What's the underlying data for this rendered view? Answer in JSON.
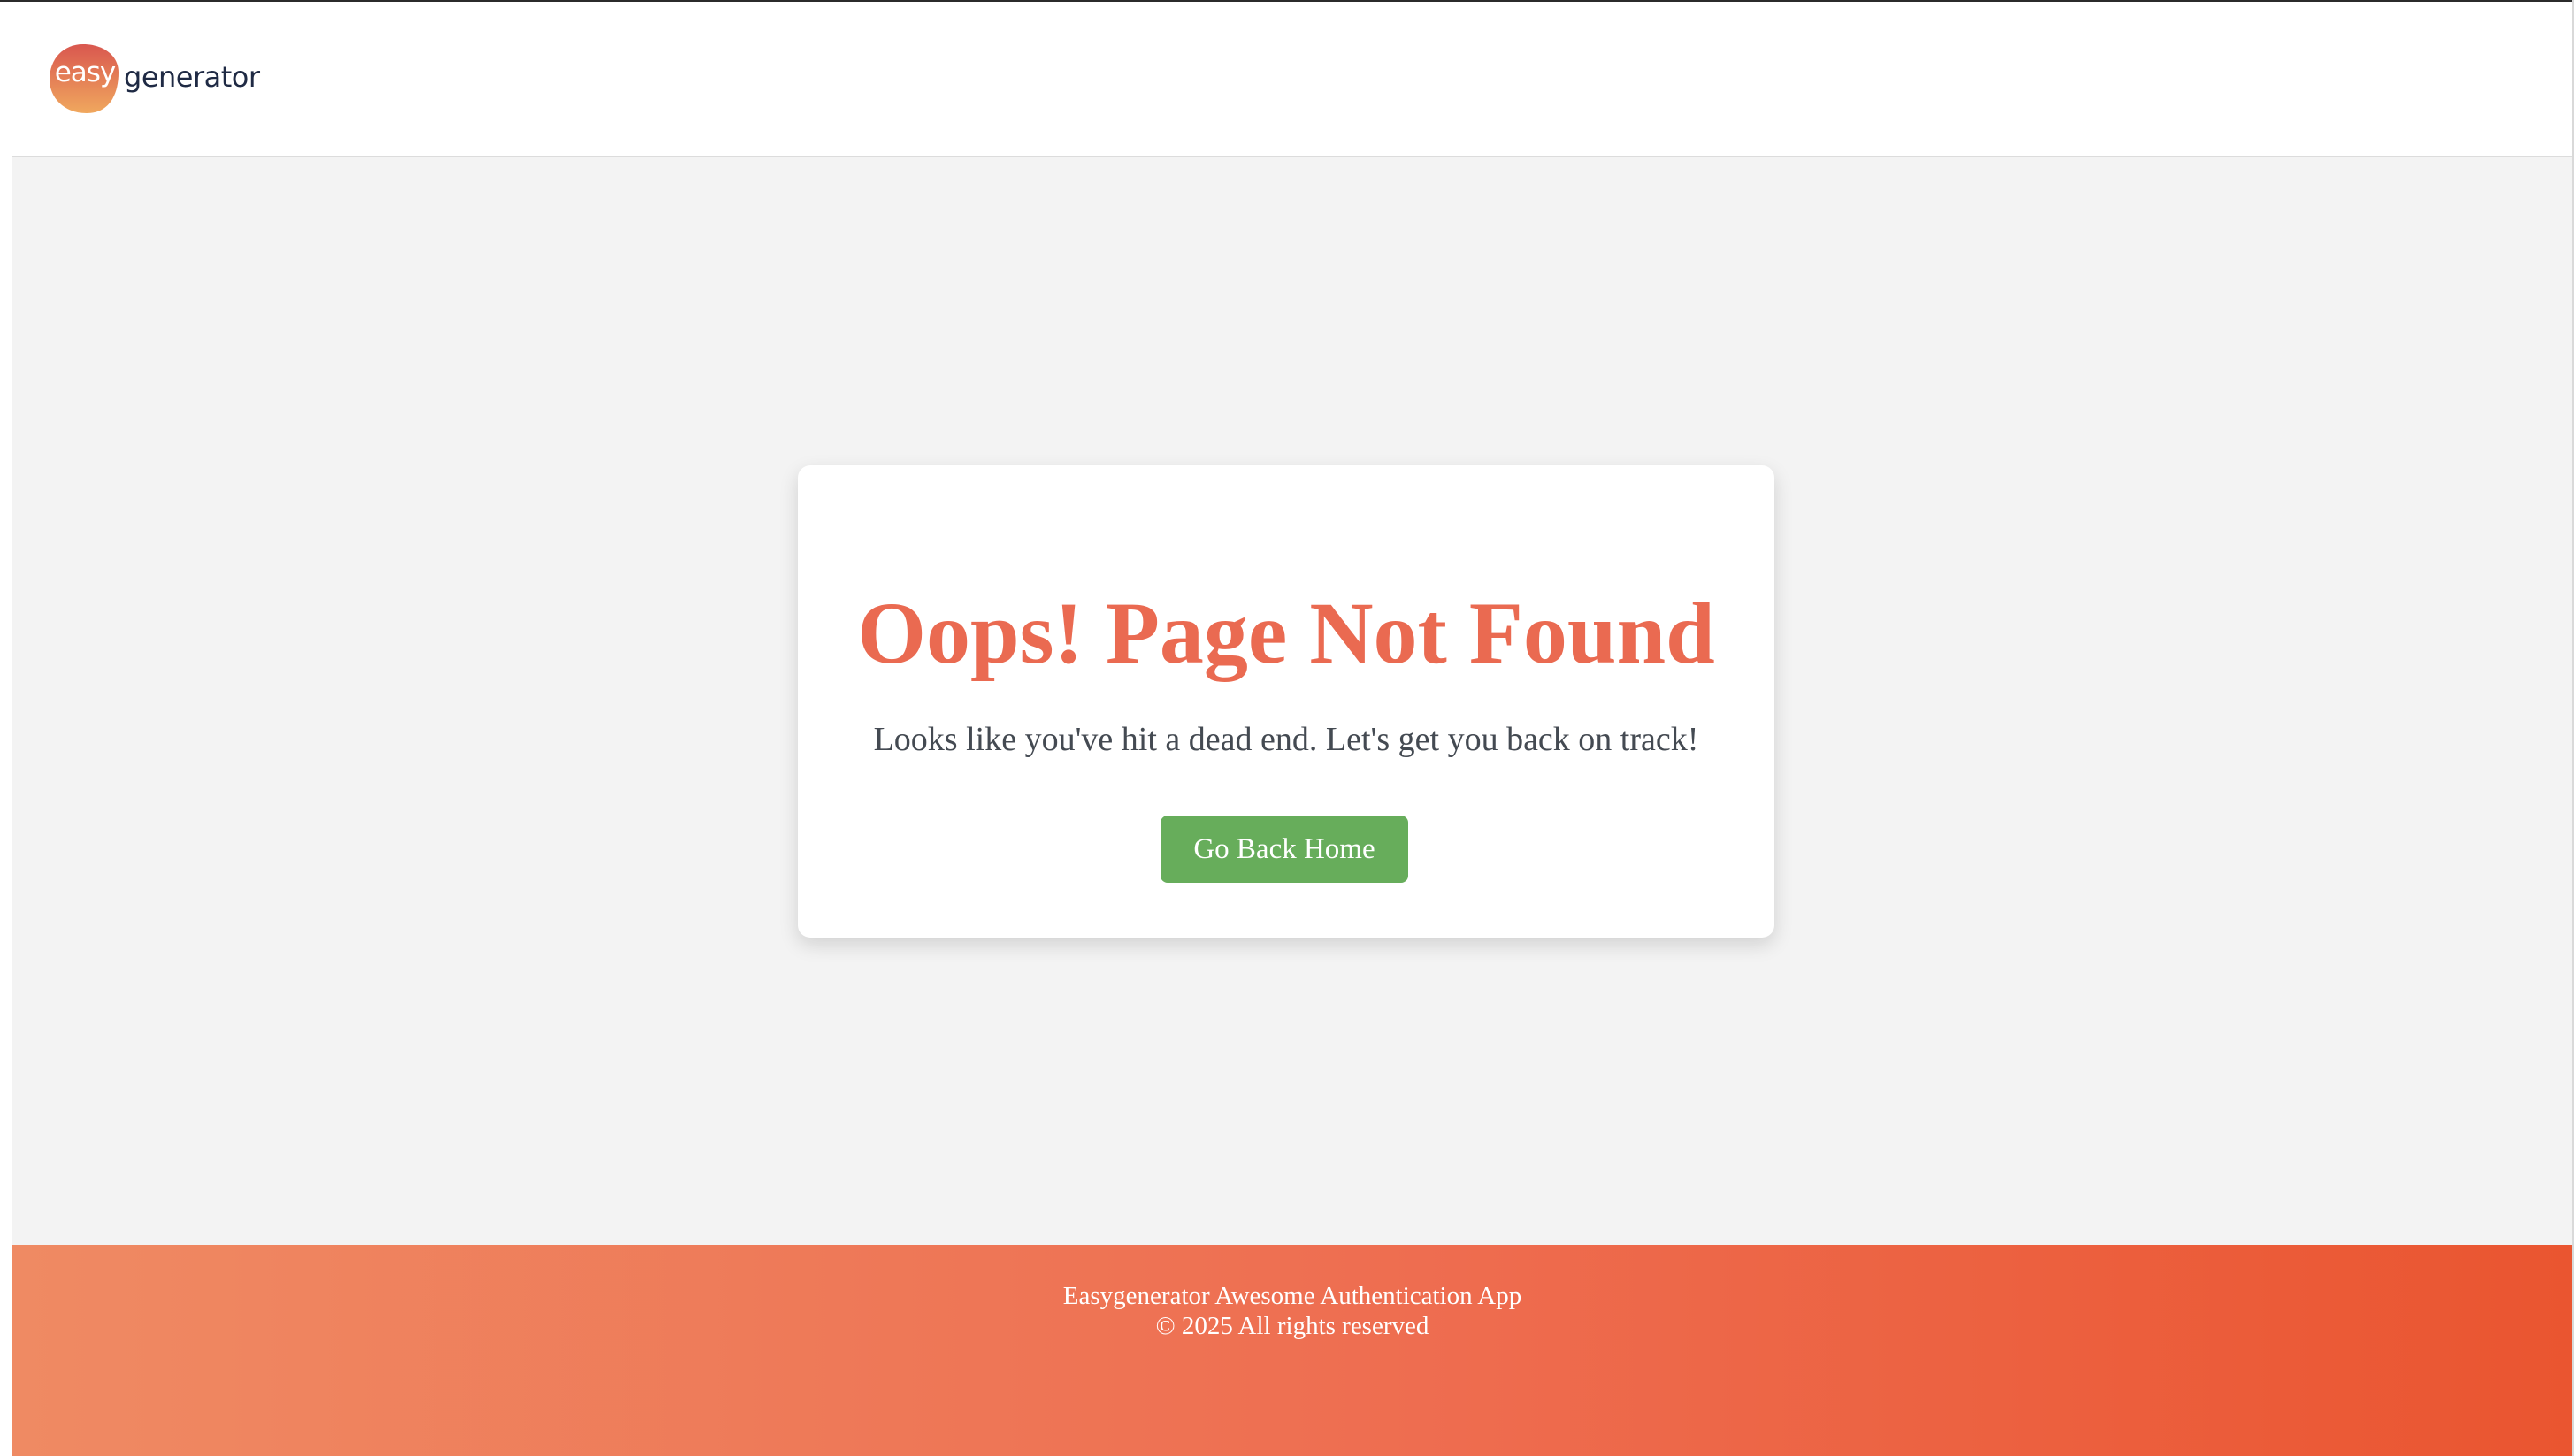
{
  "header": {
    "logo": {
      "easy_text": "easy",
      "generator_text": "generator"
    }
  },
  "card": {
    "title": "Oops! Page Not Found",
    "message": "Looks like you've hit a dead end. Let's get you back on track!",
    "button_label": "Go Back Home"
  },
  "footer": {
    "line1": "Easygenerator Awesome Authentication App",
    "line2": "© 2025 All rights reserved"
  },
  "colors": {
    "accent": "#ea6a51",
    "button": "#67ad5b",
    "footer_gradient_start": "#ef8a63",
    "footer_gradient_end": "#ea5530",
    "background": "#f3f3f3"
  }
}
